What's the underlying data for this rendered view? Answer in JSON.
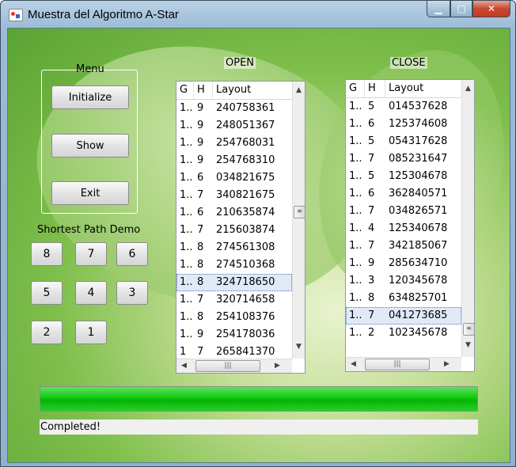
{
  "window": {
    "title": "Muestra del Algoritmo A-Star",
    "controls": {
      "minimize": "▁",
      "maximize": "□",
      "close": "✕"
    }
  },
  "menu": {
    "legend": "Menu",
    "buttons": {
      "initialize": "Initialize",
      "show": "Show",
      "exit": "Exit"
    }
  },
  "demo": {
    "legend": "Shortest Path Demo",
    "tiles": [
      "8",
      "7",
      "6",
      "5",
      "4",
      "3",
      "2",
      "1"
    ]
  },
  "open_table": {
    "label": "OPEN",
    "columns": [
      "G",
      "H",
      "Layout"
    ],
    "rows": [
      [
        "1..",
        "9",
        "240758361"
      ],
      [
        "1..",
        "9",
        "248051367"
      ],
      [
        "1..",
        "9",
        "254768031"
      ],
      [
        "1..",
        "9",
        "254768310"
      ],
      [
        "1..",
        "6",
        "034821675"
      ],
      [
        "1..",
        "7",
        "340821675"
      ],
      [
        "1..",
        "6",
        "210635874"
      ],
      [
        "1..",
        "7",
        "215603874"
      ],
      [
        "1..",
        "8",
        "274561308"
      ],
      [
        "1..",
        "8",
        "274510368"
      ],
      [
        "1..",
        "8",
        "324718650"
      ],
      [
        "1..",
        "7",
        "320714658"
      ],
      [
        "1..",
        "8",
        "254108376"
      ],
      [
        "1..",
        "9",
        "254178036"
      ],
      [
        "1",
        "7",
        "265841370"
      ]
    ],
    "selected_row": 10
  },
  "close_table": {
    "label": "CLOSE",
    "columns": [
      "G",
      "H",
      "Layout"
    ],
    "rows": [
      [
        "1..",
        "5",
        "014537628"
      ],
      [
        "1..",
        "6",
        "125374608"
      ],
      [
        "1..",
        "5",
        "054317628"
      ],
      [
        "1..",
        "7",
        "085231647"
      ],
      [
        "1..",
        "5",
        "125304678"
      ],
      [
        "1..",
        "6",
        "362840571"
      ],
      [
        "1..",
        "7",
        "034826571"
      ],
      [
        "1..",
        "4",
        "125340678"
      ],
      [
        "1..",
        "7",
        "342185067"
      ],
      [
        "1..",
        "9",
        "285634710"
      ],
      [
        "1..",
        "3",
        "120345678"
      ],
      [
        "1..",
        "8",
        "634825701"
      ],
      [
        "1..",
        "7",
        "041273685"
      ],
      [
        "1..",
        "2",
        "102345678"
      ]
    ],
    "selected_row": 12
  },
  "scroll_icons": {
    "up": "▲",
    "down": "▼",
    "left": "◀",
    "right": "▶",
    "grip_v": "≡",
    "grip_h": "|||"
  },
  "progress": {
    "value": 1.0,
    "color": "#11c911"
  },
  "status": {
    "text": "Completed!"
  }
}
